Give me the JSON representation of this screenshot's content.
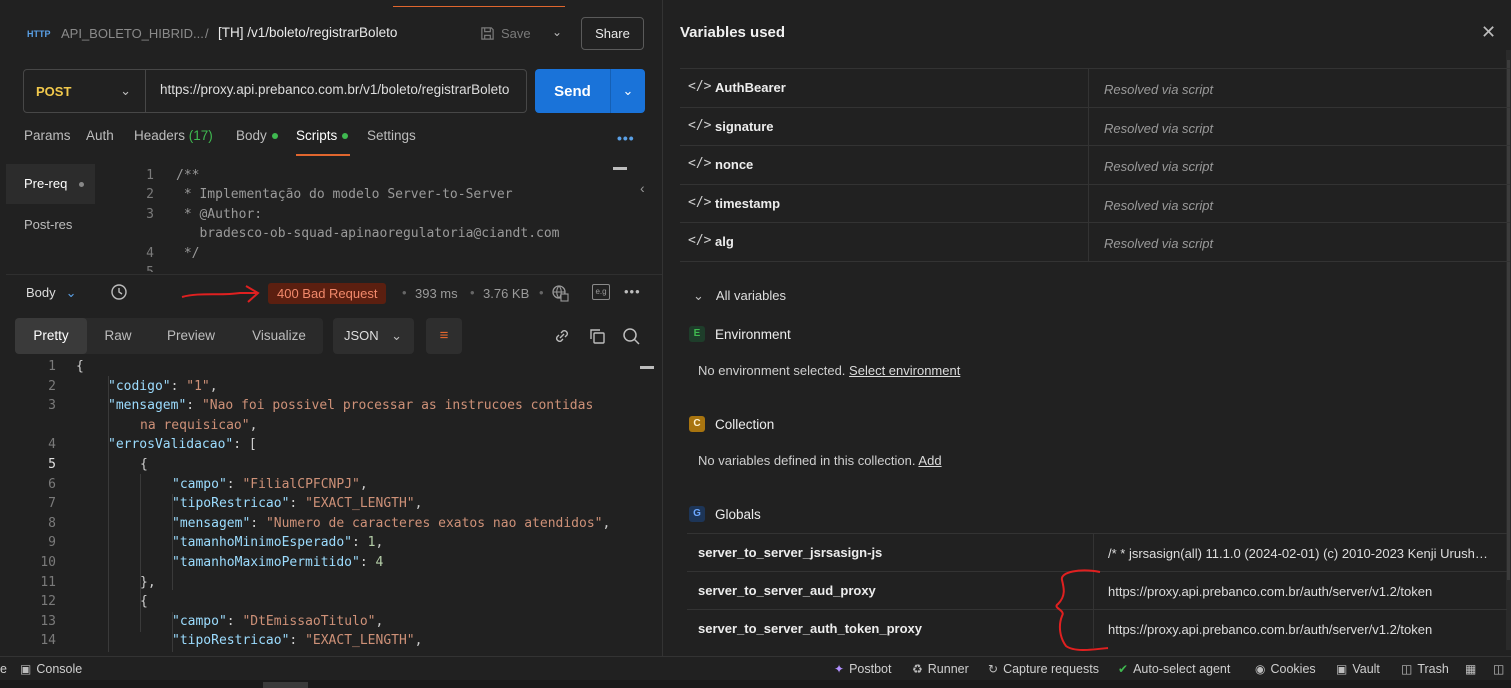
{
  "request": {
    "collection": "API_BOLETO_HIBRID...",
    "separator": "/",
    "name": "[TH] /v1/boleto/registrarBoleto",
    "save_label": "Save",
    "share_label": "Share",
    "method": "POST",
    "url": "https://proxy.api.prebanco.com.br/v1/boleto/registrarBoleto",
    "send_label": "Send",
    "http_icon_text": "HTTP"
  },
  "req_tabs": [
    {
      "label": "Params"
    },
    {
      "label": "Auth"
    },
    {
      "label": "Headers",
      "count": "(17)"
    },
    {
      "label": "Body"
    },
    {
      "label": "Scripts"
    },
    {
      "label": "Settings"
    }
  ],
  "scripts": {
    "side": [
      "Pre-req",
      "Post-res"
    ],
    "lines": [
      {
        "n": "1",
        "t": "/**"
      },
      {
        "n": "2",
        "t": " * Implementação do modelo Server-to-Server"
      },
      {
        "n": "3",
        "t": " * @Author:"
      },
      {
        "n": "",
        "t": "   bradesco-ob-squad-apinaoregulatoria@ciandt.com"
      },
      {
        "n": "4",
        "t": " */"
      },
      {
        "n": "5",
        "t": ""
      }
    ]
  },
  "response": {
    "body_label": "Body",
    "status": "400 Bad Request",
    "time": "393 ms",
    "size": "3.76 KB",
    "views": [
      "Pretty",
      "Raw",
      "Preview",
      "Visualize"
    ],
    "format": "JSON",
    "lines": [
      {
        "n": "1",
        "i": 0,
        "parts": [
          [
            "p",
            "{"
          ]
        ]
      },
      {
        "n": "2",
        "i": 1,
        "parts": [
          [
            "k",
            "\"codigo\""
          ],
          [
            "p",
            ": "
          ],
          [
            "s",
            "\"1\""
          ],
          [
            "p",
            ","
          ]
        ]
      },
      {
        "n": "3",
        "i": 1,
        "parts": [
          [
            "k",
            "\"mensagem\""
          ],
          [
            "p",
            ": "
          ],
          [
            "s",
            "\"Nao foi possivel processar as instrucoes contidas"
          ]
        ]
      },
      {
        "n": "",
        "i": 2,
        "parts": [
          [
            "s",
            "na requisicao\""
          ],
          [
            "p",
            ","
          ]
        ]
      },
      {
        "n": "4",
        "i": 1,
        "parts": [
          [
            "k",
            "\"errosValidacao\""
          ],
          [
            "p",
            ": ["
          ]
        ]
      },
      {
        "n": "5",
        "i": 2,
        "parts": [
          [
            "p",
            "{"
          ]
        ]
      },
      {
        "n": "6",
        "i": 3,
        "parts": [
          [
            "k",
            "\"campo\""
          ],
          [
            "p",
            ": "
          ],
          [
            "s",
            "\"FilialCPFCNPJ\""
          ],
          [
            "p",
            ","
          ]
        ]
      },
      {
        "n": "7",
        "i": 3,
        "parts": [
          [
            "k",
            "\"tipoRestricao\""
          ],
          [
            "p",
            ": "
          ],
          [
            "s",
            "\"EXACT_LENGTH\""
          ],
          [
            "p",
            ","
          ]
        ]
      },
      {
        "n": "8",
        "i": 3,
        "parts": [
          [
            "k",
            "\"mensagem\""
          ],
          [
            "p",
            ": "
          ],
          [
            "s",
            "\"Numero de caracteres exatos nao atendidos\""
          ],
          [
            "p",
            ","
          ]
        ]
      },
      {
        "n": "9",
        "i": 3,
        "parts": [
          [
            "k",
            "\"tamanhoMinimoEsperado\""
          ],
          [
            "p",
            ": "
          ],
          [
            "n",
            "1"
          ],
          [
            "p",
            ","
          ]
        ]
      },
      {
        "n": "10",
        "i": 3,
        "parts": [
          [
            "k",
            "\"tamanhoMaximoPermitido\""
          ],
          [
            "p",
            ": "
          ],
          [
            "n",
            "4"
          ]
        ]
      },
      {
        "n": "11",
        "i": 2,
        "parts": [
          [
            "p",
            "},"
          ]
        ]
      },
      {
        "n": "12",
        "i": 2,
        "parts": [
          [
            "p",
            "{"
          ]
        ]
      },
      {
        "n": "13",
        "i": 3,
        "parts": [
          [
            "k",
            "\"campo\""
          ],
          [
            "p",
            ": "
          ],
          [
            "s",
            "\"DtEmissaoTitulo\""
          ],
          [
            "p",
            ","
          ]
        ]
      },
      {
        "n": "14",
        "i": 3,
        "parts": [
          [
            "k",
            "\"tipoRestricao\""
          ],
          [
            "p",
            ": "
          ],
          [
            "s",
            "\"EXACT_LENGTH\""
          ],
          [
            "p",
            ","
          ]
        ]
      }
    ]
  },
  "variables_panel": {
    "title": "Variables used",
    "used": [
      {
        "name": "AuthBearer",
        "value": "Resolved via script"
      },
      {
        "name": "signature",
        "value": "Resolved via script"
      },
      {
        "name": "nonce",
        "value": "Resolved via script"
      },
      {
        "name": "timestamp",
        "value": "Resolved via script"
      },
      {
        "name": "alg",
        "value": "Resolved via script"
      }
    ],
    "all_label": "All variables",
    "environment": {
      "badge": "E",
      "label": "Environment",
      "msg": "No environment selected.",
      "link": "Select environment"
    },
    "collection": {
      "badge": "C",
      "label": "Collection",
      "msg": "No variables defined in this collection.",
      "link": "Add"
    },
    "globals": {
      "badge": "G",
      "label": "Globals",
      "rows": [
        {
          "name": "server_to_server_jsrsasign-js",
          "value": "/* * jsrsasign(all) 11.1.0 (2024-02-01) (c) 2010-2023 Kenji Urushima"
        },
        {
          "name": "server_to_server_aud_proxy",
          "value": "https://proxy.api.prebanco.com.br/auth/server/v1.2/token"
        },
        {
          "name": "server_to_server_auth_token_proxy",
          "value": "https://proxy.api.prebanco.com.br/auth/server/v1.2/token"
        }
      ]
    }
  },
  "status_bar": {
    "left_partial": "e",
    "console": "Console",
    "postbot": "Postbot",
    "runner": "Runner",
    "capture": "Capture requests",
    "autoselect": "Auto-select agent",
    "cookies": "Cookies",
    "vault": "Vault",
    "trash": "Trash"
  },
  "colors": {
    "accent": "#e0662e",
    "send": "#1a73d9",
    "method": "#f2c94c",
    "status_bg": "#5b1f10",
    "status_fg": "#f2896b",
    "green_dot": "#3fb950"
  }
}
